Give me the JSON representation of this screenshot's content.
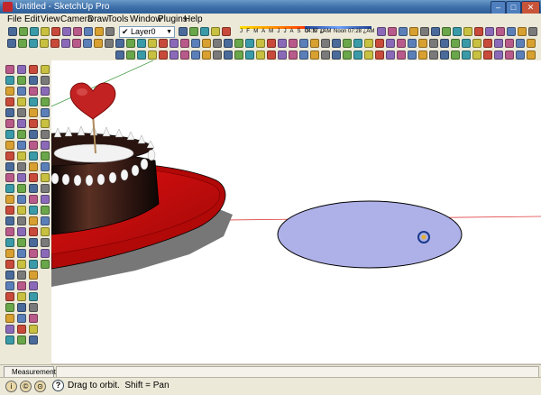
{
  "window": {
    "title": "Untitled - SketchUp Pro",
    "min_glyph": "–",
    "max_glyph": "□",
    "close_glyph": "✕"
  },
  "menu": [
    "File",
    "Edit",
    "View",
    "Camera",
    "Draw",
    "Tools",
    "Window",
    "Plugins",
    "Help"
  ],
  "layers": {
    "current": "Layer0"
  },
  "shadows": {
    "months": "J F M A M J J A S O N D",
    "time_start": "04:37 ¿AM",
    "time_noon": "Noon",
    "time_end": "07:28 ¿AM"
  },
  "measurements": {
    "label": "Measurements"
  },
  "status": {
    "hint": "Drag to orbit.  Shift = Pan",
    "help_glyph": "?",
    "circle_glyphs": [
      "i",
      "©",
      "⊙"
    ]
  }
}
